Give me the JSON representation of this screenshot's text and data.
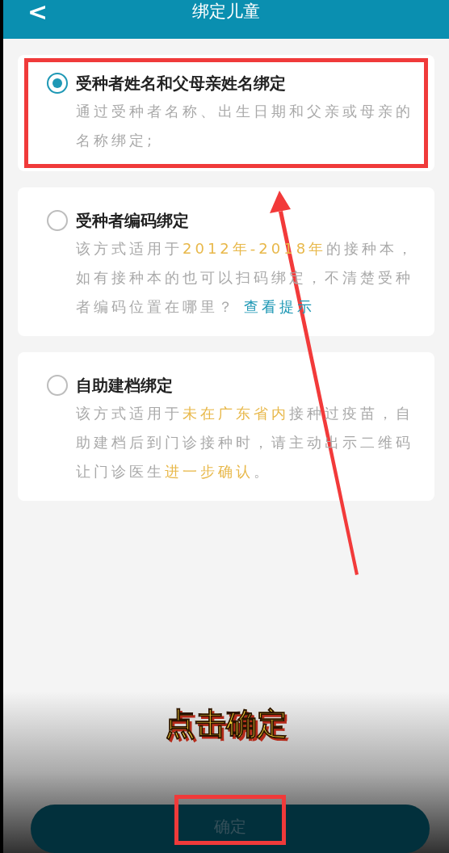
{
  "header": {
    "back": "<",
    "title": "绑定儿童"
  },
  "options": [
    {
      "title": "受种者姓名和父母亲姓名绑定",
      "selected": true,
      "highlighted": true,
      "description": [
        {
          "kind": "plain",
          "text": "通过受种者名称、出生日期和父亲或母亲的名称绑定;"
        }
      ]
    },
    {
      "title": "受种者编码绑定",
      "selected": false,
      "highlighted": false,
      "description": [
        {
          "kind": "plain",
          "text": "该方式适用于"
        },
        {
          "kind": "highlight",
          "text": "2012年-2018年"
        },
        {
          "kind": "plain",
          "text": "的接种本，如有接种本的也可以扫码绑定，不清楚受种者编码位置在哪里？ "
        },
        {
          "kind": "link",
          "text": "查看提示"
        }
      ]
    },
    {
      "title": "自助建档绑定",
      "selected": false,
      "highlighted": false,
      "description": [
        {
          "kind": "plain",
          "text": "该方式适用于"
        },
        {
          "kind": "highlight",
          "text": "未在广东省内"
        },
        {
          "kind": "plain",
          "text": "接种过疫苗，自助建档后到门诊接种时，请主动出示二维码让门诊医生"
        },
        {
          "kind": "highlight",
          "text": "进一步确认"
        },
        {
          "kind": "plain",
          "text": "。"
        }
      ]
    }
  ],
  "caption": "点击确定",
  "confirm_button": {
    "label": "确定",
    "highlighted": true
  }
}
